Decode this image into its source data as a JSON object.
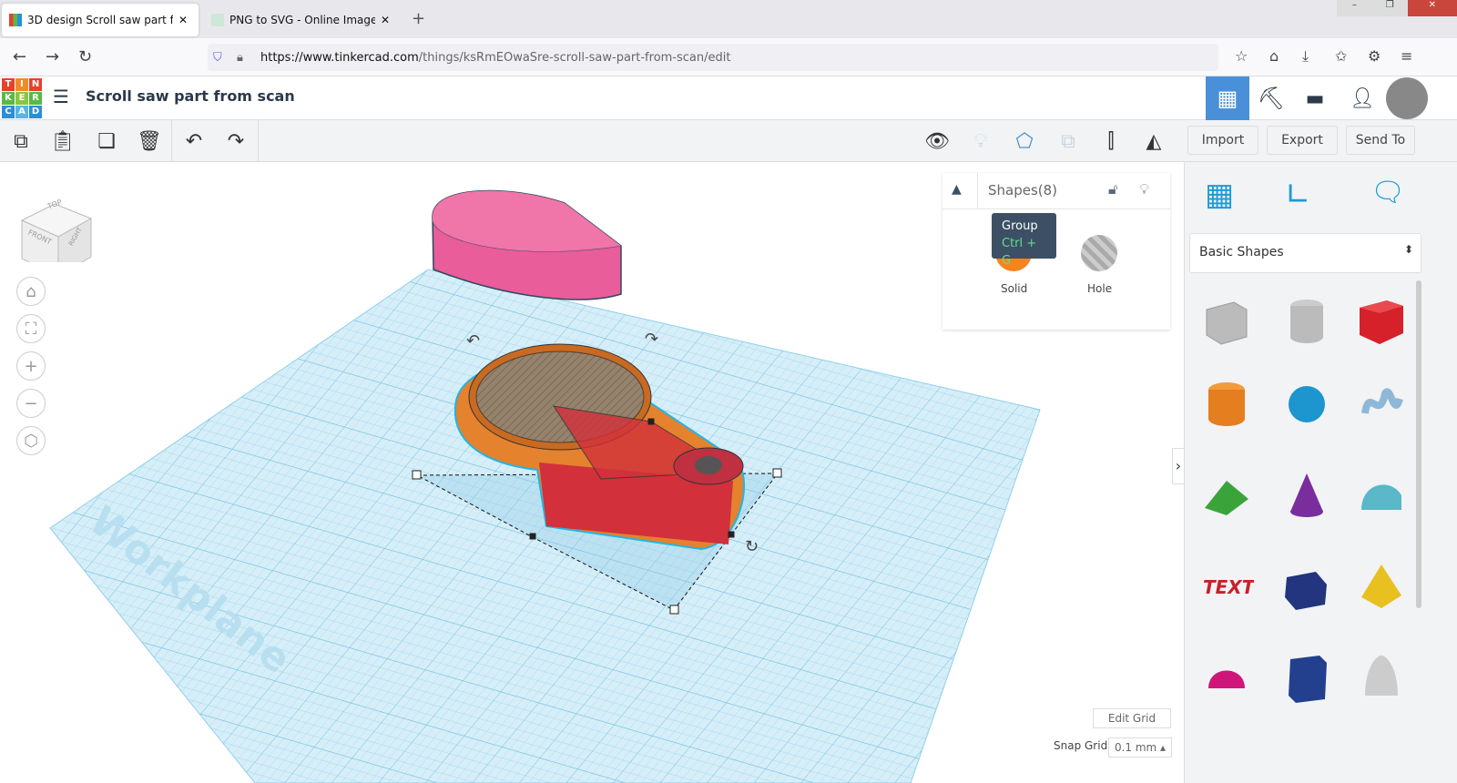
{
  "browser": {
    "tabs": [
      {
        "title": "3D design Scroll saw part from scan",
        "active": true
      },
      {
        "title": "PNG to SVG - Online Image Vector",
        "active": false
      }
    ],
    "new_tab": "+",
    "url_host": "https://www.tinkercad.com",
    "url_path": "/things/ksRmEOwaSre-scroll-saw-part-from-scan/edit"
  },
  "logo": [
    "T",
    "I",
    "N",
    "K",
    "E",
    "R",
    "C",
    "A",
    "D"
  ],
  "app": {
    "title": "Scroll saw part from scan"
  },
  "toolbar": {
    "import": "Import",
    "export": "Export",
    "send_to": "Send To"
  },
  "tooltip": {
    "label": "Group",
    "shortcut": "Ctrl + G"
  },
  "inspector": {
    "title": "Shapes(8)",
    "solid": "Solid",
    "hole": "Hole"
  },
  "viewcube": {
    "top": "TOP",
    "front": "FRONT",
    "right": "RIGHT"
  },
  "workplane_label": "Workplane",
  "library": {
    "category": "Basic Shapes"
  },
  "grid": {
    "edit": "Edit Grid",
    "snap_label": "Snap Grid",
    "snap_value": "0.1 mm"
  },
  "colors": {
    "accent": "#4a90d9",
    "solid": "#f5841f",
    "tinkercad_red": "#e8402a"
  }
}
